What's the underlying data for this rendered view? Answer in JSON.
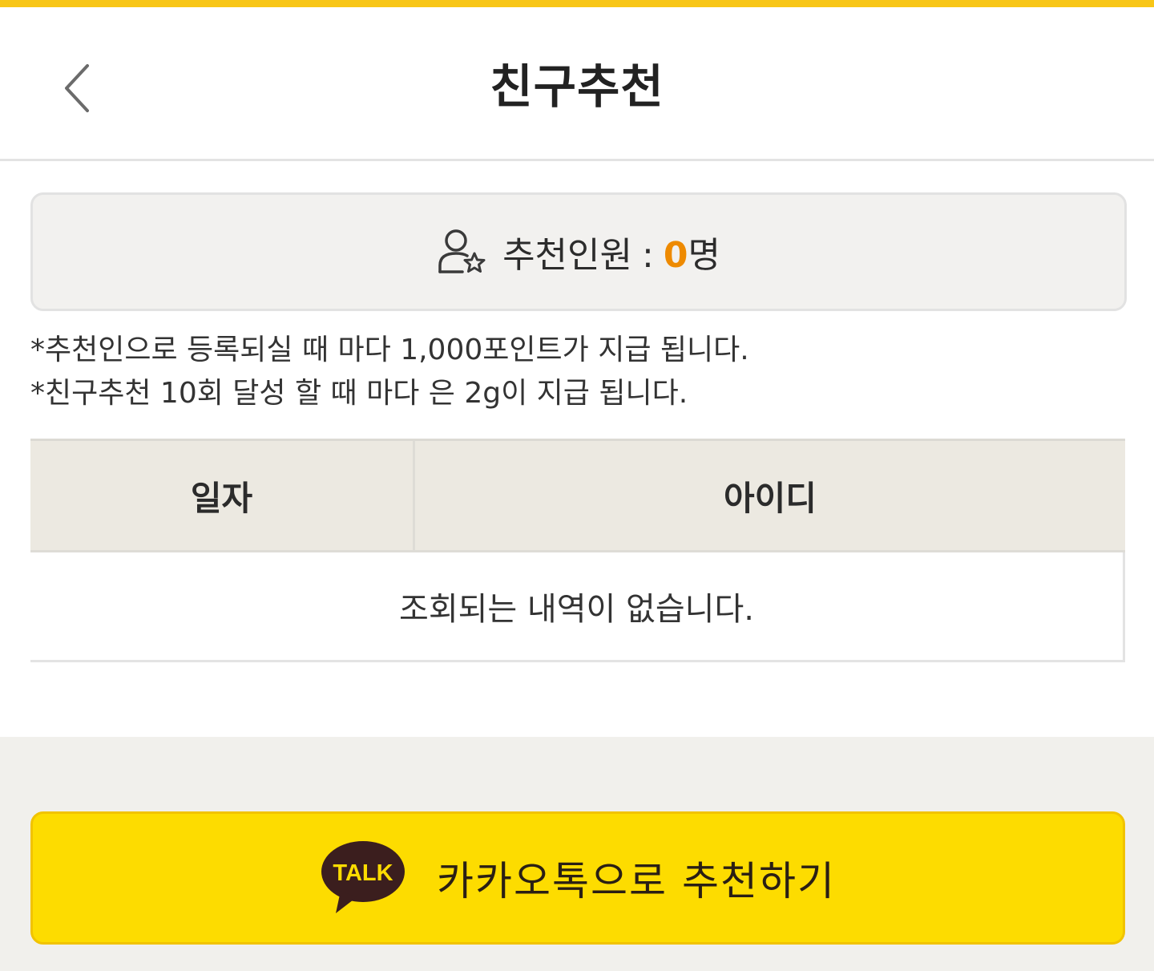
{
  "header": {
    "title": "친구추천",
    "back_icon": "chevron-left-icon"
  },
  "count": {
    "icon": "user-star-icon",
    "label": "추천인원",
    "separator": ":",
    "value": "0",
    "unit": "명"
  },
  "notes": [
    "*추천인으로 등록되실 때 마다 1,000포인트가 지급 됩니다.",
    "*친구추천 10회 달성 할 때 마다 은 2g이 지급 됩니다."
  ],
  "table": {
    "columns": [
      "일자",
      "아이디"
    ],
    "empty_message": "조회되는 내역이 없습니다."
  },
  "kakao_button": {
    "icon": "kakao-talk-icon",
    "icon_text": "TALK",
    "label": "카카오톡으로 추천하기"
  },
  "colors": {
    "accent_top": "#f8c617",
    "count_highlight": "#ee8a00",
    "kakao_yellow": "#fddc00",
    "kakao_brown": "#3b1e1e"
  }
}
